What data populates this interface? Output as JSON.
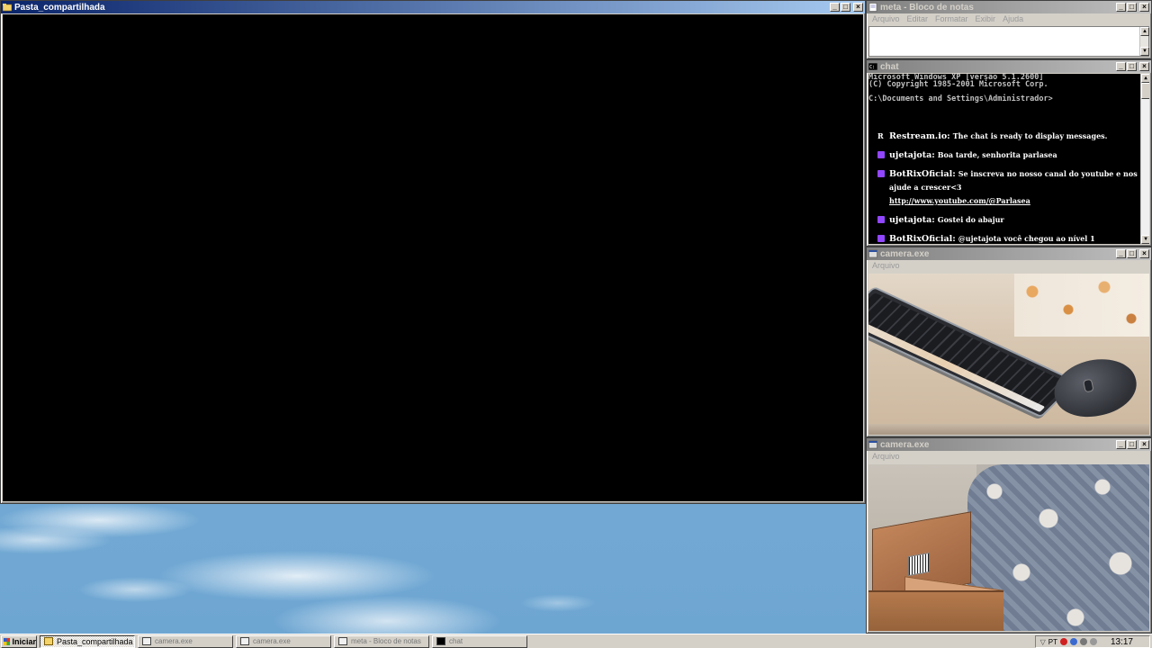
{
  "windows": {
    "pasta": {
      "title": "Pasta_compartilhada"
    },
    "notepad": {
      "title": "meta - Bloco de notas",
      "menu": [
        "Arquivo",
        "Editar",
        "Formatar",
        "Exibir",
        "Ajuda"
      ]
    },
    "chat": {
      "title": "chat",
      "console_lines": [
        "Microsoft Windows XP [versão 5.1.2600]",
        "(C) Copyright 1985-2001 Microsoft Corp.",
        "",
        "C:\\Documents and Settings\\Administrador>"
      ],
      "messages": [
        {
          "source": "restream",
          "user": "Restream.io:",
          "text": "The chat is ready to display messages."
        },
        {
          "source": "twitch",
          "user": "ujetajota:",
          "text": "Boa tarde, senhorita parlasea"
        },
        {
          "source": "twitch",
          "user": "BotRixOficial:",
          "text": "Se inscreva no nosso canal do youtube e nos ajude a crescer<3",
          "link": "http://www.youtube.com/@Parlasea"
        },
        {
          "source": "twitch",
          "user": "ujetajota:",
          "text": "Gostei do abajur"
        },
        {
          "source": "twitch",
          "user": "BotRixOficial:",
          "text": "@ujetajota você chegou ao nível 1"
        }
      ]
    },
    "camera1": {
      "title": "camera.exe",
      "menu": [
        "Arquivo"
      ]
    },
    "camera2": {
      "title": "camera.exe",
      "menu": [
        "Arquivo"
      ]
    }
  },
  "window_buttons": {
    "minimize": "_",
    "maximize": "□",
    "close": "×"
  },
  "taskbar": {
    "start_label": "Iniciar",
    "tasks": [
      {
        "label": "Pasta_compartilhada",
        "icon": "folder-icon",
        "active": true
      },
      {
        "label": "camera.exe",
        "icon": "app-icon",
        "active": false
      },
      {
        "label": "camera.exe",
        "icon": "app-icon",
        "active": false
      },
      {
        "label": "meta - Bloco de notas",
        "icon": "notepad-icon",
        "active": false
      },
      {
        "label": "chat",
        "icon": "cmd-icon",
        "active": false
      }
    ],
    "tray_lang": "PT",
    "clock": "13:17"
  },
  "colors": {
    "title_active": "#0a246a",
    "title_inactive": "#808080",
    "twitch": "#9146ff"
  }
}
